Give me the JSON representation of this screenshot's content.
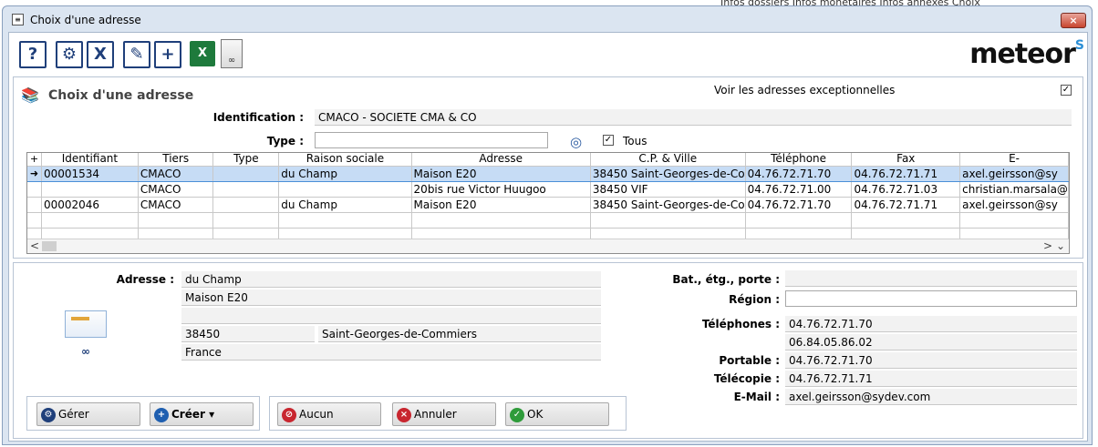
{
  "background": {
    "text": "Infos dossiers   Infos monétaires   Infos annexes   Choix"
  },
  "window": {
    "title": "Choix d'une adresse",
    "close": "×"
  },
  "toolbar": {
    "help": "?",
    "settings": "⚙",
    "cancel": "X",
    "edit": "✎",
    "add": "+",
    "excel": "X",
    "logo": "meteor"
  },
  "panel": {
    "title": "Choix d'une adresse",
    "exceptional_label": "Voir les adresses exceptionnelles",
    "exceptional_checked": true,
    "identification_label": "Identification :",
    "identification_value": "CMACO - SOCIETE CMA & CO",
    "type_label": "Type :",
    "type_value": "",
    "tous_label": "Tous",
    "tous_checked": true
  },
  "grid": {
    "columns": [
      "Identifiant",
      "Tiers",
      "Type",
      "Raison sociale",
      "Adresse",
      "C.P. & Ville",
      "Téléphone",
      "Fax",
      "E-"
    ],
    "rows": [
      [
        "00001534",
        "CMACO",
        "",
        "du Champ",
        "Maison E20",
        "38450 Saint-Georges-de-Co",
        "04.76.72.71.70",
        "04.76.72.71.71",
        "axel.geirsson@sy"
      ],
      [
        "",
        "CMACO",
        "",
        "",
        "20bis rue Victor Huugoo",
        "38450 VIF",
        "04.76.72.71.00",
        "04.76.72.71.03",
        "christian.marsala@"
      ],
      [
        "00002046",
        "CMACO",
        "",
        "du Champ",
        "Maison E20",
        "38450 Saint-Georges-de-Co",
        "04.76.72.71.70",
        "04.76.72.71.71",
        "axel.geirsson@sy"
      ]
    ]
  },
  "details": {
    "adresse_label": "Adresse :",
    "adresse_line1": "du Champ",
    "adresse_line2": "Maison E20",
    "adresse_line3": "",
    "cp": "38450",
    "ville": "Saint-Georges-de-Commiers",
    "pays": "France",
    "bat_label": "Bat., étg., porte :",
    "bat_value": "",
    "region_label": "Région :",
    "region_value": "",
    "telephones_label": "Téléphones :",
    "telephone1": "04.76.72.71.70",
    "telephone2": "06.84.05.86.02",
    "portable_label": "Portable :",
    "portable": "04.76.72.71.70",
    "telecopie_label": "Télécopie :",
    "telecopie": "04.76.72.71.71",
    "email_label": "E-Mail :",
    "email": "axel.geirsson@sydev.com"
  },
  "buttons": {
    "gerer": "Gérer",
    "creer": "Créer",
    "aucun": "Aucun",
    "annuler": "Annuler",
    "ok": "OK"
  },
  "colors": {
    "selection": "#c6dcf5",
    "window_frame": "#dbe5f1",
    "accent": "#1f3f7a"
  }
}
